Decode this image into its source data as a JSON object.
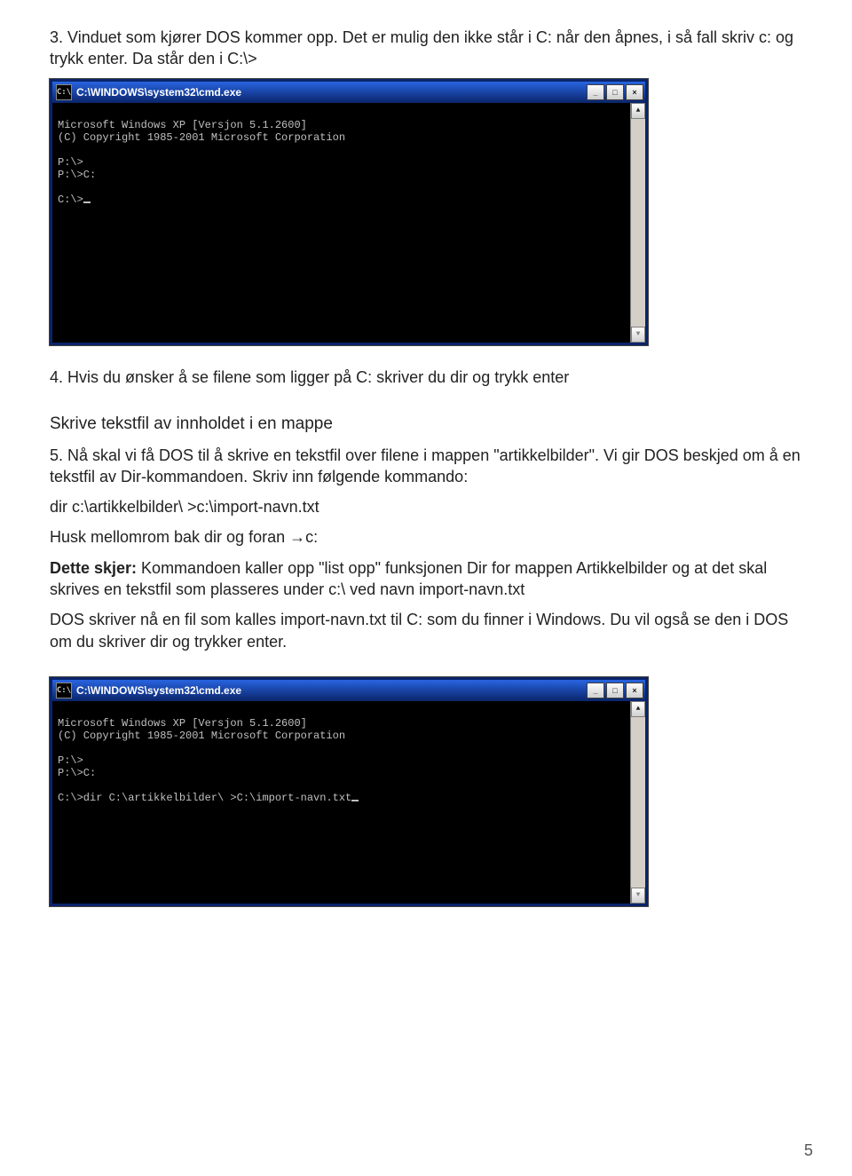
{
  "para1": "3. Vinduet som kjører DOS kommer opp.  Det er mulig den ikke står i C: når den åpnes, i så fall skriv c: og trykk enter. Da står den i C:\\>",
  "cmd1": {
    "title_prefix": "C:\\",
    "title": "C:\\WINDOWS\\system32\\cmd.exe",
    "line1": "Microsoft Windows XP [Versjon 5.1.2600]",
    "line2": "(C) Copyright 1985-2001 Microsoft Corporation",
    "line3": "P:\\>",
    "line4": "P:\\>C:",
    "line5": "C:\\>"
  },
  "para2": "4. Hvis du ønsker å se filene som ligger på C: skriver du dir og trykk enter",
  "section_title": "Skrive tekstfil av innholdet i en mappe",
  "para3": "5. Nå skal vi få DOS til å skrive en tekstfil over filene i mappen \"artikkelbilder\". Vi gir DOS beskjed om å en tekstfil av Dir-kommandoen. Skriv inn følgende kommando:",
  "cmd_line_example": "dir  c:\\artikkelbilder\\  >c:\\import-navn.txt",
  "para4": "Husk mellomrom bak dir og foran →c:",
  "para5_bold": "Dette skjer:",
  "para5_rest": " Kommandoen kaller opp \"list opp\" funksjonen Dir for mappen Artikkelbilder og at det skal skrives en tekstfil som plasseres under c:\\ ved navn import-navn.txt",
  "para6": "DOS skriver nå en fil som kalles import-navn.txt til C: som du finner i Windows. Du vil også se den i DOS om du skriver dir og trykker enter.",
  "cmd2": {
    "title_prefix": "C:\\",
    "title": "C:\\WINDOWS\\system32\\cmd.exe",
    "line1": "Microsoft Windows XP [Versjon 5.1.2600]",
    "line2": "(C) Copyright 1985-2001 Microsoft Corporation",
    "line3": "P:\\>",
    "line4": "P:\\>C:",
    "line5": "C:\\>dir C:\\artikkelbilder\\ >C:\\import-navn.txt"
  },
  "win_buttons": {
    "min": "_",
    "max": "□",
    "close": "×"
  },
  "scroll": {
    "up": "▲",
    "down": "▼"
  },
  "page_number": "5"
}
